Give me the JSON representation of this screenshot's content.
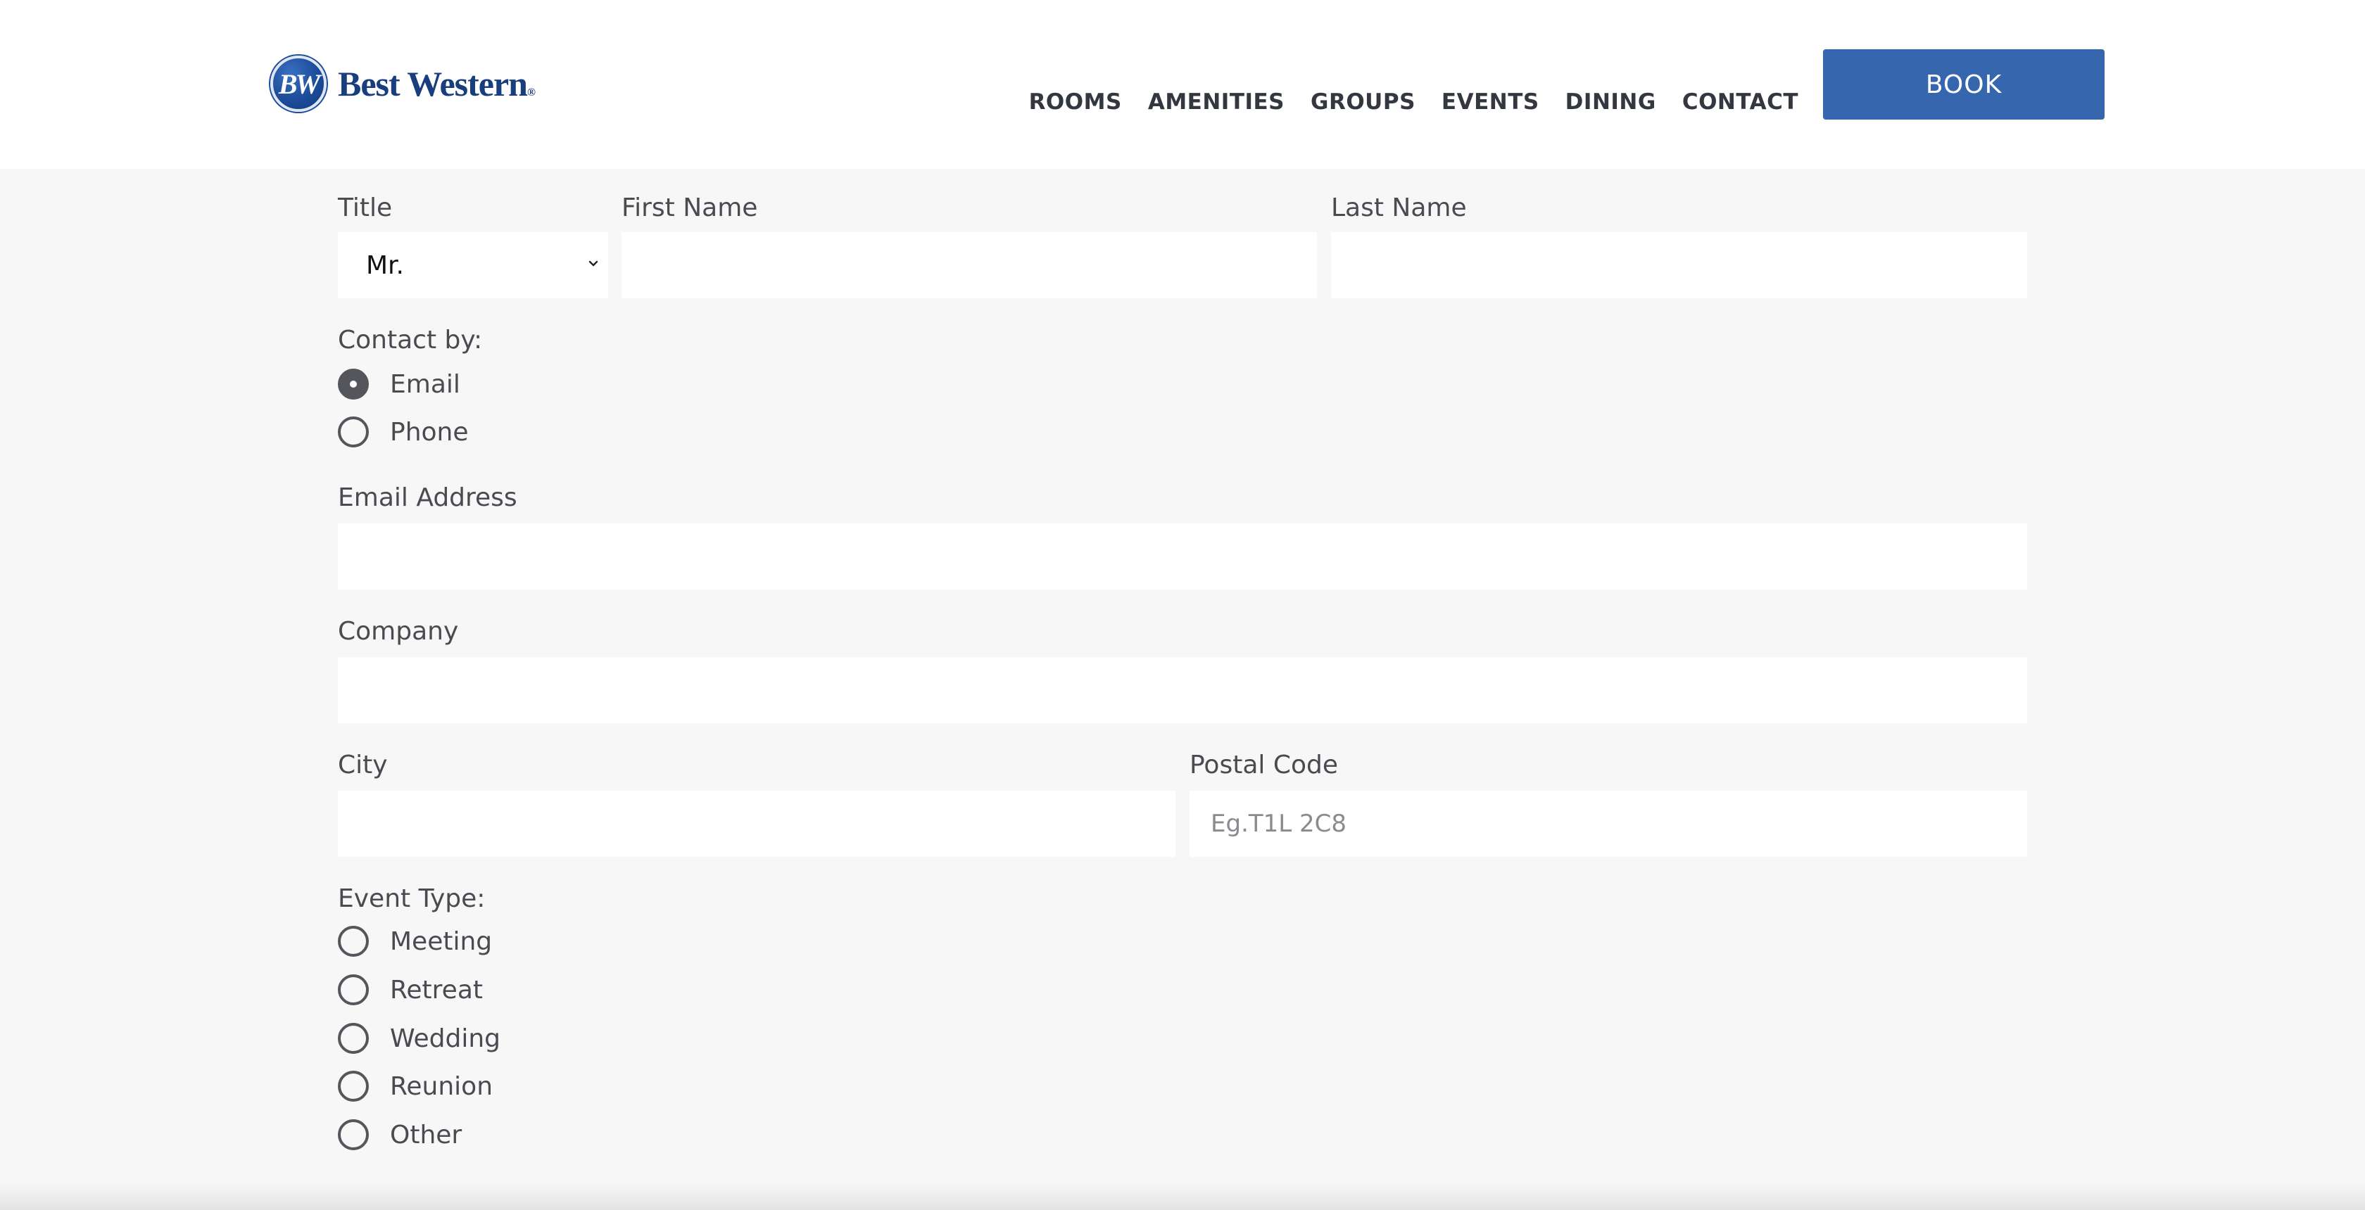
{
  "brand": {
    "badge": "BW",
    "name": "Best Western",
    "mark": "®"
  },
  "nav": {
    "items": [
      "ROOMS",
      "AMENITIES",
      "GROUPS",
      "EVENTS",
      "DINING",
      "CONTACT"
    ],
    "book_label": "BOOK"
  },
  "form": {
    "title_label": "Title",
    "title_value": "Mr.",
    "first_name_label": "First Name",
    "first_name_value": "",
    "last_name_label": "Last Name",
    "last_name_value": "",
    "contact_by_label": "Contact by:",
    "contact_options": [
      "Email",
      "Phone"
    ],
    "contact_selected": "Email",
    "email_label": "Email Address",
    "email_value": "",
    "company_label": "Company",
    "company_value": "",
    "city_label": "City",
    "city_value": "",
    "postal_label": "Postal Code",
    "postal_placeholder": "Eg.T1L 2C8",
    "event_type_label": "Event Type:",
    "event_options": [
      "Meeting",
      "Retreat",
      "Wedding",
      "Reunion",
      "Other"
    ]
  },
  "colors": {
    "brand_blue": "#3566ae",
    "logo_blue": "#183e7e",
    "page_bg": "#f7f7f7"
  },
  "icons": {
    "logo": "bw-logo-icon",
    "select": "chevron-down-icon"
  }
}
